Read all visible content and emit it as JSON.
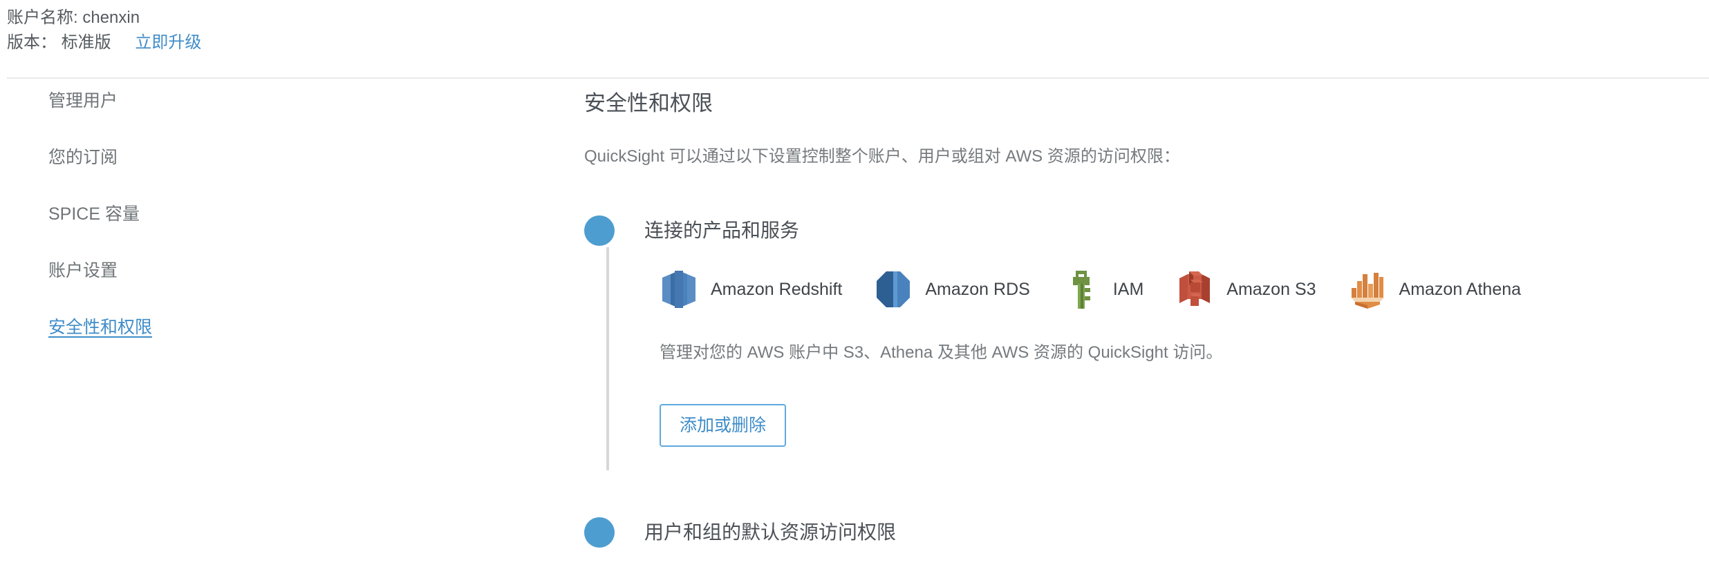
{
  "account": {
    "name_label": "账户名称:",
    "name_value": "chenxin",
    "edition_label": "版本：",
    "edition_value": "标准版",
    "upgrade_link": "立即升级"
  },
  "sidebar": {
    "items": [
      {
        "label": "管理用户",
        "active": false
      },
      {
        "label": "您的订阅",
        "active": false
      },
      {
        "label": "SPICE 容量",
        "active": false
      },
      {
        "label": "账户设置",
        "active": false
      },
      {
        "label": "安全性和权限",
        "active": true
      }
    ]
  },
  "main": {
    "title": "安全性和权限",
    "description": "QuickSight 可以通过以下设置控制整个账户、用户或组对 AWS 资源的访问权限：",
    "sections": [
      {
        "title": "连接的产品和服务",
        "services": [
          {
            "name": "Amazon Redshift",
            "icon": "amazon-redshift-icon"
          },
          {
            "name": "Amazon RDS",
            "icon": "amazon-rds-icon"
          },
          {
            "name": "IAM",
            "icon": "iam-key-icon"
          },
          {
            "name": "Amazon S3",
            "icon": "amazon-s3-icon"
          },
          {
            "name": "Amazon Athena",
            "icon": "amazon-athena-icon"
          }
        ],
        "manage_text": "管理对您的 AWS 账户中 S3、Athena 及其他 AWS 资源的 QuickSight 访问。",
        "button_label": "添加或删除"
      },
      {
        "title": "用户和组的默认资源访问权限"
      }
    ]
  },
  "colors": {
    "accent_blue": "#3f8cc8",
    "bullet_blue": "#4d9dd0",
    "text_gray": "#757a7e",
    "divider": "#e9e9e9",
    "rule": "#d7d7d7"
  }
}
